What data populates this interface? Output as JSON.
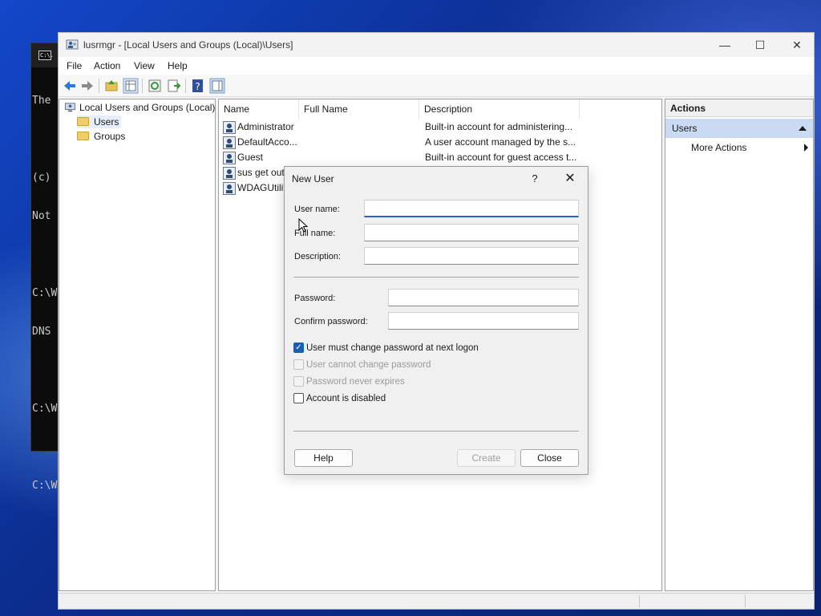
{
  "console": {
    "icon_label": "C:\\.",
    "lines": [
      "The",
      "",
      "(c)",
      "Not",
      "",
      "C:\\W",
      "DNS",
      "",
      "C:\\W",
      "",
      "C:\\W"
    ]
  },
  "window": {
    "title": "lusrmgr - [Local Users and Groups (Local)\\Users]",
    "min_glyph": "—",
    "max_glyph": "☐",
    "close_glyph": "✕"
  },
  "menu": [
    "File",
    "Action",
    "View",
    "Help"
  ],
  "tree": {
    "root": "Local Users and Groups (Local)",
    "items": [
      "Users",
      "Groups"
    ]
  },
  "list": {
    "columns": [
      "Name",
      "Full Name",
      "Description"
    ],
    "rows": [
      {
        "name": "Administrator",
        "full_name": "",
        "description": "Built-in account for administering..."
      },
      {
        "name": "DefaultAcco...",
        "full_name": "",
        "description": "A user account managed by the s..."
      },
      {
        "name": "Guest",
        "full_name": "",
        "description": "Built-in account for guest access t..."
      },
      {
        "name": "sus get out",
        "full_name": "",
        "description": ""
      },
      {
        "name": "WDAGUtilit",
        "full_name": "",
        "description": ""
      }
    ]
  },
  "actions": {
    "title": "Actions",
    "section": "Users",
    "more_actions": "More Actions"
  },
  "dialog": {
    "title": "New User",
    "help_glyph": "?",
    "close_glyph": "✕",
    "labels": {
      "user_name": "User name:",
      "full_name": "Full name:",
      "description": "Description:",
      "password": "Password:",
      "confirm_password": "Confirm password:"
    },
    "values": {
      "user_name": "",
      "full_name": "",
      "description": "",
      "password": "",
      "confirm_password": ""
    },
    "checkboxes": [
      {
        "label": "User must change password at next logon",
        "checked": true,
        "enabled": true
      },
      {
        "label": "User cannot change password",
        "checked": false,
        "enabled": false
      },
      {
        "label": "Password never expires",
        "checked": false,
        "enabled": false
      },
      {
        "label": "Account is disabled",
        "checked": false,
        "enabled": true
      }
    ],
    "buttons": {
      "help": "Help",
      "create": "Create",
      "close": "Close"
    }
  },
  "colors": {
    "accent": "#1a5fb4",
    "selection": "#c9daf2",
    "disabled_text": "#9a9a9a"
  }
}
